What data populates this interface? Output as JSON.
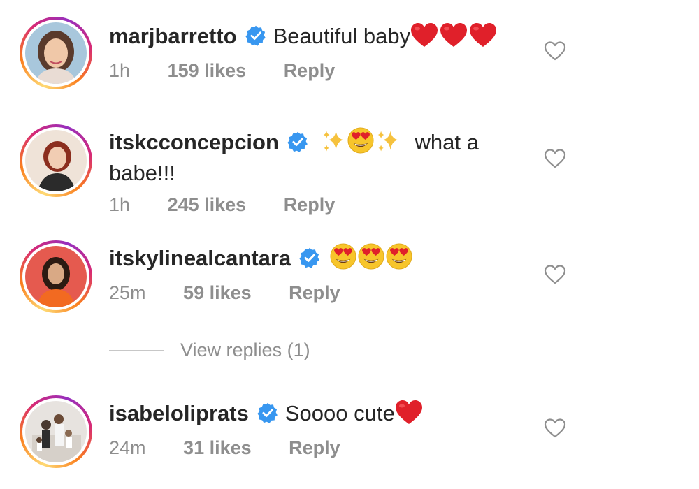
{
  "comments": [
    {
      "username": "marjbarretto",
      "text": "Beautiful baby",
      "time": "1h",
      "likes": "159 likes",
      "reply": "Reply"
    },
    {
      "username": "itskcconcepcion",
      "text_after": "what a babe!!!",
      "time": "1h",
      "likes": "245 likes",
      "reply": "Reply"
    },
    {
      "username": "itskylinealcantara",
      "time": "25m",
      "likes": "59 likes",
      "reply": "Reply"
    },
    {
      "username": "isabeloliprats",
      "text": "Soooo cute",
      "time": "24m",
      "likes": "31 likes",
      "reply": "Reply"
    }
  ],
  "view_replies": "View replies (1)",
  "colors": {
    "verified": "#3897f0",
    "heart_red": "#e0202a",
    "meta_gray": "#8e8e8e"
  },
  "icons": [
    "verified-badge-icon",
    "red-heart-emoji",
    "sparkles-emoji",
    "heart-eyes-emoji",
    "like-heart-icon"
  ]
}
